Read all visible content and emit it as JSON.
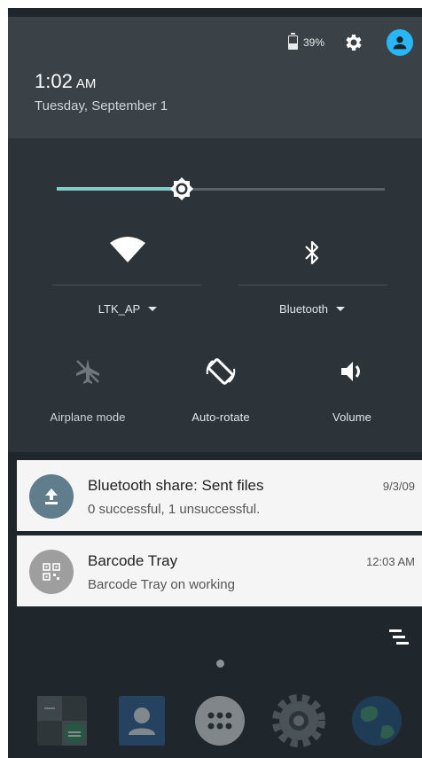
{
  "status": {
    "battery": "39%"
  },
  "header": {
    "time": "1:02",
    "ampm": "AM",
    "date": "Tuesday, September 1"
  },
  "brightness": {
    "level": 0.38
  },
  "tiles": {
    "wifi": {
      "label": "LTK_AP",
      "icon": "wifi-icon"
    },
    "bluetooth": {
      "label": "Bluetooth",
      "icon": "bluetooth-icon"
    },
    "airplane": {
      "label": "Airplane mode",
      "icon": "airplane-icon"
    },
    "autorotate": {
      "label": "Auto-rotate",
      "icon": "rotate-icon"
    },
    "volume": {
      "label": "Volume",
      "icon": "volume-icon"
    }
  },
  "notifications": [
    {
      "title": "Bluetooth share: Sent files",
      "text": "0 successful, 1 unsuccessful.",
      "time": "9/3/09",
      "icon": "upload-icon",
      "color": "#607d8b"
    },
    {
      "title": "Barcode Tray",
      "text": "Barcode Tray on working",
      "time": "12:03 AM",
      "icon": "barcode-icon",
      "color": "#9e9e9e"
    }
  ],
  "dock": [
    "calculator-icon",
    "contacts-icon",
    "apps-icon",
    "settings-icon",
    "browser-icon"
  ],
  "colors": {
    "accent": "#80cbc4",
    "avatar": "#29b6f6"
  }
}
